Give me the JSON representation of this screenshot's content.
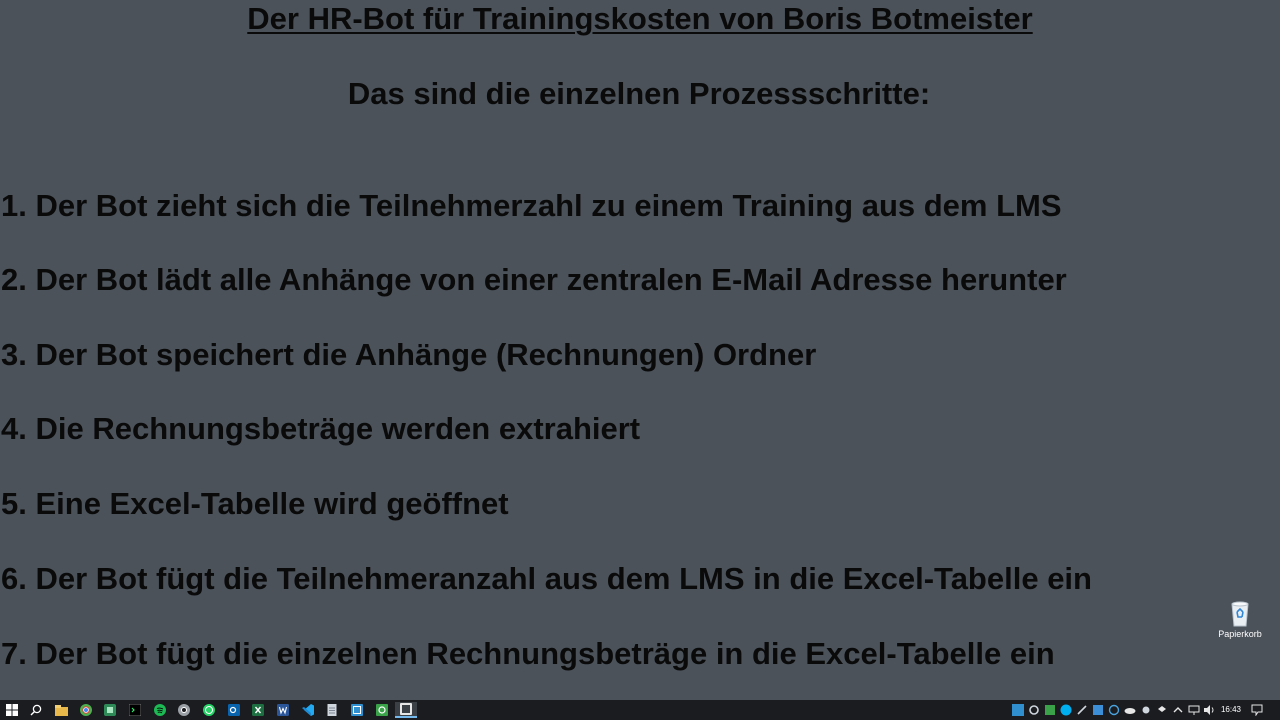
{
  "slide": {
    "title": "Der HR-Bot für Trainingskosten von Boris Botmeister",
    "subtitle": "Das sind die einzelnen Prozessschritte:",
    "steps": [
      "1. Der Bot zieht sich die Teilnehmerzahl zu einem Training aus dem LMS",
      "2. Der Bot lädt alle Anhänge von einer zentralen E-Mail Adresse herunter",
      "3. Der Bot speichert die Anhänge (Rechnungen) Ordner",
      "4. Die Rechnungsbeträge werden extrahiert",
      "5. Eine Excel-Tabelle wird geöffnet",
      "6. Der Bot fügt die Teilnehmeranzahl aus dem LMS in die Excel-Tabelle ein",
      "7. Der Bot fügt die einzelnen Rechnungsbeträge in die Excel-Tabelle ein"
    ]
  },
  "desktop": {
    "recycle_bin_label": "Papierkorb"
  },
  "taskbar": {
    "apps": [
      {
        "name": "start-icon",
        "color": "#ffffff"
      },
      {
        "name": "search-icon",
        "color": "#ffffff"
      },
      {
        "name": "file-explorer-icon",
        "color": "#e8b84a"
      },
      {
        "name": "chrome-icon",
        "color": "#4caf50"
      },
      {
        "name": "app-green-icon",
        "color": "#2e8b57"
      },
      {
        "name": "terminal-icon",
        "color": "#202020"
      },
      {
        "name": "spotify-icon",
        "color": "#1db954"
      },
      {
        "name": "chromium-icon",
        "color": "#9aa0a6"
      },
      {
        "name": "whatsapp-icon",
        "color": "#25d366"
      },
      {
        "name": "outlook-icon",
        "color": "#0a64ad"
      },
      {
        "name": "excel-icon",
        "color": "#1d6f42"
      },
      {
        "name": "word-icon",
        "color": "#2b579a"
      },
      {
        "name": "vscode-icon",
        "color": "#23a9f2"
      },
      {
        "name": "notepad-icon",
        "color": "#d0d6de"
      },
      {
        "name": "uipath-studio-icon",
        "color": "#2f8fcf"
      },
      {
        "name": "uipath-assistant-icon",
        "color": "#3aa34a"
      },
      {
        "name": "active-window-icon",
        "color": "#e6e6e6"
      }
    ],
    "clock": "16:43"
  }
}
